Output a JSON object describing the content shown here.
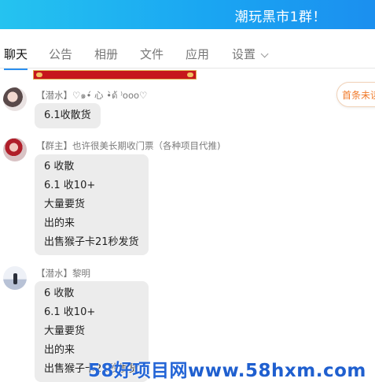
{
  "window": {
    "title": "潮玩黑市1群！"
  },
  "tabs": [
    {
      "label": "聊天",
      "active": true
    },
    {
      "label": "公告"
    },
    {
      "label": "相册"
    },
    {
      "label": "文件"
    },
    {
      "label": "应用"
    },
    {
      "label": "设置"
    }
  ],
  "pill": {
    "label": "首条未读"
  },
  "messages": [
    {
      "sender": "【潜水】♡๑•́ 心 •̀ด้ ⁾ᴏᴏᴏ♡",
      "lines": [
        "6.1收散货"
      ]
    },
    {
      "sender": "【群主】也许很美长期收门票（各种项目代推)",
      "lines": [
        "6   收散",
        "6.1 收10+",
        "大量要货",
        "出的来",
        "出售猴子卡21秒发货"
      ]
    },
    {
      "sender": "【潜水】黎明",
      "lines": [
        "6   收散",
        "6.1 收10+",
        "大量要货",
        "出的来",
        "出售猴子卡21秒发货"
      ]
    }
  ],
  "watermark": {
    "cn": "58好项目网",
    "url": "www.58hxm.com"
  },
  "colors": {
    "titlebar": "#1aa6f2",
    "accent": "#2b8ff0",
    "bubble": "#ececec"
  }
}
